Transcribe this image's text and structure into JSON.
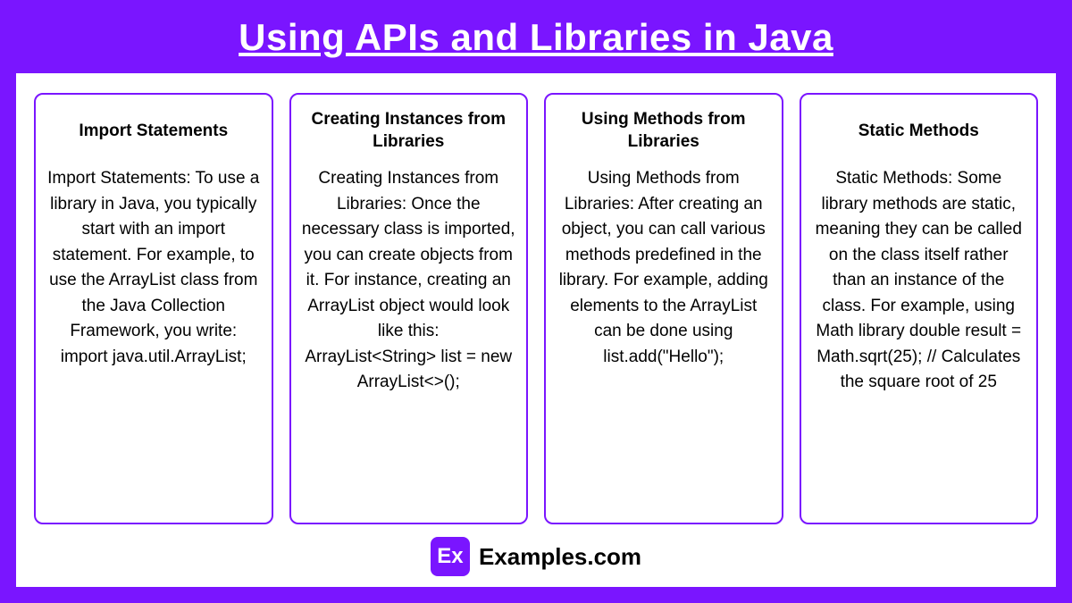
{
  "title": "Using APIs and Libraries in Java",
  "cards": [
    {
      "title": "Import Statements",
      "body": "Import Statements: To use a library in Java, you typically start with an import statement. For example, to use the ArrayList class from the Java Collection Framework, you write:\nimport java.util.ArrayList;"
    },
    {
      "title": "Creating Instances from Libraries",
      "body": "Creating Instances from Libraries: Once the necessary class is imported, you can create objects from it. For instance, creating an ArrayList object would look like this:\nArrayList<String> list = new ArrayList<>();"
    },
    {
      "title": "Using Methods from Libraries",
      "body": "Using Methods from Libraries: After creating an object, you can call various methods predefined in the library. For example, adding elements to the ArrayList can be done using list.add(\"Hello\");"
    },
    {
      "title": "Static Methods",
      "body": "Static Methods: Some library methods are static, meaning they can be called on the class itself rather than an instance of the class. For example, using Math library double result = Math.sqrt(25); // Calculates the square root of 25"
    }
  ],
  "footer": {
    "logo": "Ex",
    "text": "Examples.com"
  }
}
